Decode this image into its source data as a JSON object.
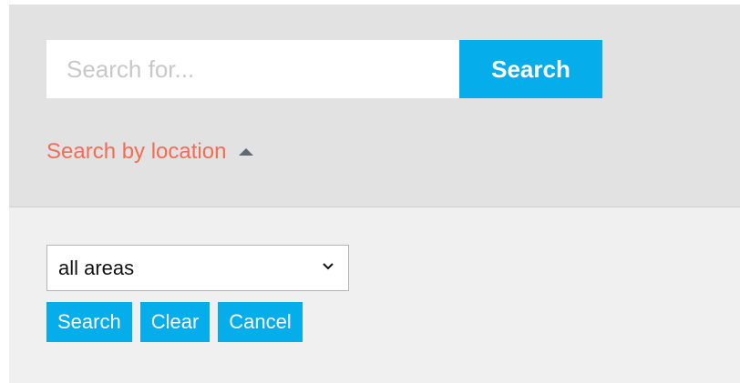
{
  "search": {
    "placeholder": "Search for...",
    "value": "",
    "button_label": "Search"
  },
  "location_toggle": {
    "label": "Search by location",
    "icon": "caret-up-icon",
    "link_color": "#f26d54"
  },
  "area_filter": {
    "selected": "all areas",
    "options": [
      "all areas"
    ]
  },
  "actions": {
    "search_label": "Search",
    "clear_label": "Clear",
    "cancel_label": "Cancel"
  },
  "colors": {
    "accent": "#05adea",
    "top_panel": "#e2e2e2",
    "bottom_panel": "#f0f0f0"
  }
}
